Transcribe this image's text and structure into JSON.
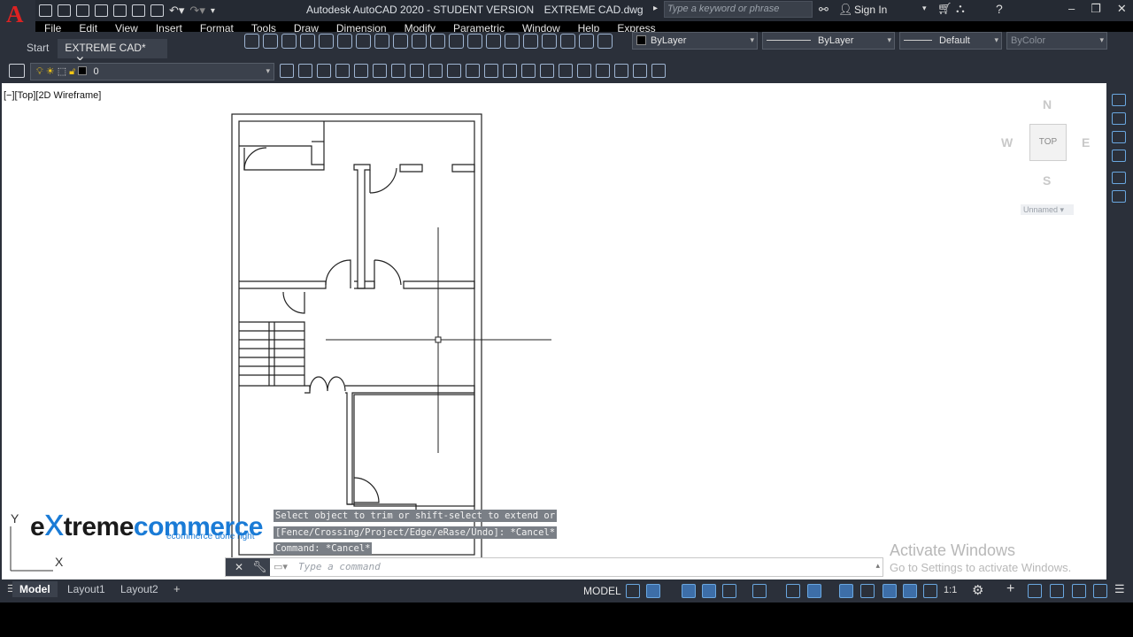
{
  "app": {
    "title": "Autodesk AutoCAD 2020 - STUDENT VERSION",
    "filename": "EXTREME CAD.dwg",
    "search_placeholder": "Type a keyword or phrase",
    "signin": "Sign In"
  },
  "menu": [
    "File",
    "Edit",
    "View",
    "Insert",
    "Format",
    "Tools",
    "Draw",
    "Dimension",
    "Modify",
    "Parametric",
    "Window",
    "Help",
    "Express"
  ],
  "tabs": {
    "start": "Start",
    "file": "EXTREME CAD*"
  },
  "properties": {
    "color": "ByLayer",
    "linetype": "ByLayer",
    "lineweight": "Default",
    "plotstyle": "ByColor"
  },
  "layer": {
    "name": "0"
  },
  "viewport": {
    "label": "[−][Top][2D Wireframe]"
  },
  "viewcube": {
    "face": "TOP",
    "n": "N",
    "s": "S",
    "e": "E",
    "w": "W",
    "ucs_name": "Unnamed"
  },
  "command_history": [
    "Select object to trim or shift-select to extend or",
    "[Fence/Crossing/Project/Edge/eRase/Undo]: *Cancel*",
    "Command: *Cancel*"
  ],
  "command_placeholder": "Type a command",
  "layout_tabs": [
    "Model",
    "Layout1",
    "Layout2"
  ],
  "status": {
    "model": "MODEL",
    "scale": "1:1"
  },
  "watermark": {
    "line1": "Activate Windows",
    "line2": "Go to Settings to activate Windows."
  },
  "branding": {
    "e": "e",
    "x": "x",
    "treme": "treme",
    "commerce": "commerce",
    "tagline": "ecommerce done right"
  },
  "ucs": {
    "y": "Y",
    "x": "X"
  }
}
